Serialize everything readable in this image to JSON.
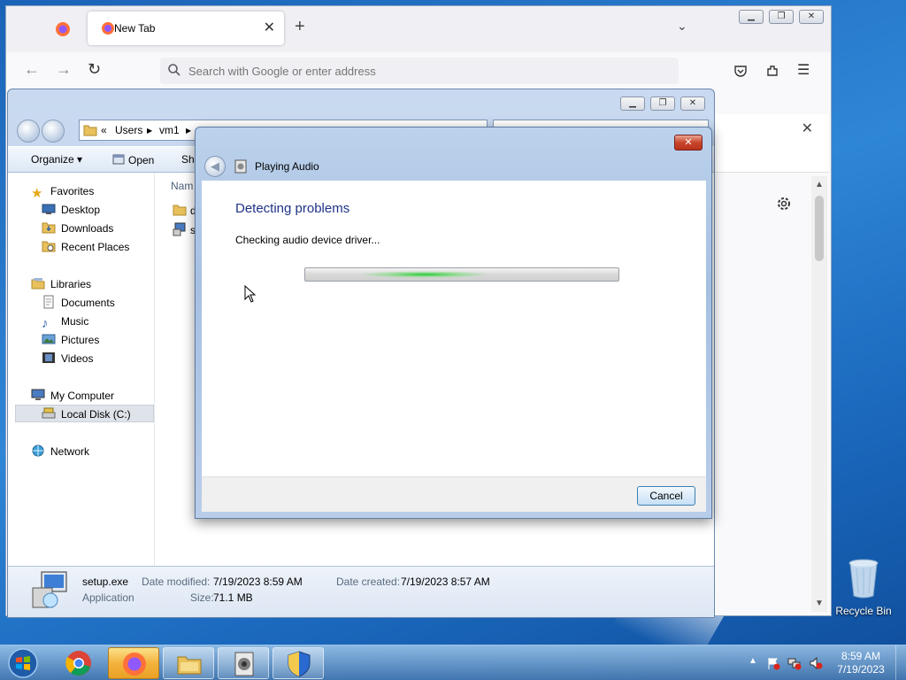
{
  "firefox": {
    "tab_title": "New Tab",
    "address_placeholder": "Search with Google or enter address"
  },
  "explorer": {
    "breadcrumb": [
      "«",
      "Users",
      "vm1"
    ],
    "toolbar": {
      "organize": "Organize",
      "open": "Open",
      "share": "Sha"
    },
    "column_header": "Nam",
    "file_rows": [
      "d",
      "s"
    ],
    "favorites": {
      "label": "Favorites",
      "items": [
        "Desktop",
        "Downloads",
        "Recent Places"
      ]
    },
    "libraries": {
      "label": "Libraries",
      "items": [
        "Documents",
        "Music",
        "Pictures",
        "Videos"
      ]
    },
    "computer": {
      "label": "My Computer",
      "items": [
        "Local Disk (C:)"
      ]
    },
    "network": {
      "label": "Network"
    },
    "details": {
      "name": "setup.exe",
      "type": "Application",
      "modified_label": "Date modified:",
      "modified_value": "7/19/2023 8:59 AM",
      "size_label": "Size:",
      "size_value": "71.1 MB",
      "created_label": "Date created:",
      "created_value": "7/19/2023 8:57 AM"
    }
  },
  "dialog": {
    "title": "Playing Audio",
    "heading": "Detecting problems",
    "status": "Checking audio device driver...",
    "cancel_label": "Cancel",
    "close_glyph": "✕",
    "back_glyph": "◀"
  },
  "desktop": {
    "recycle_bin_label": "Recycle Bin"
  },
  "taskbar": {
    "apps": [
      "chrome",
      "firefox",
      "file-explorer",
      "audio-troubleshooter",
      "security-center"
    ],
    "active_app": "firefox",
    "time": "8:59 AM",
    "date": "7/19/2023"
  }
}
